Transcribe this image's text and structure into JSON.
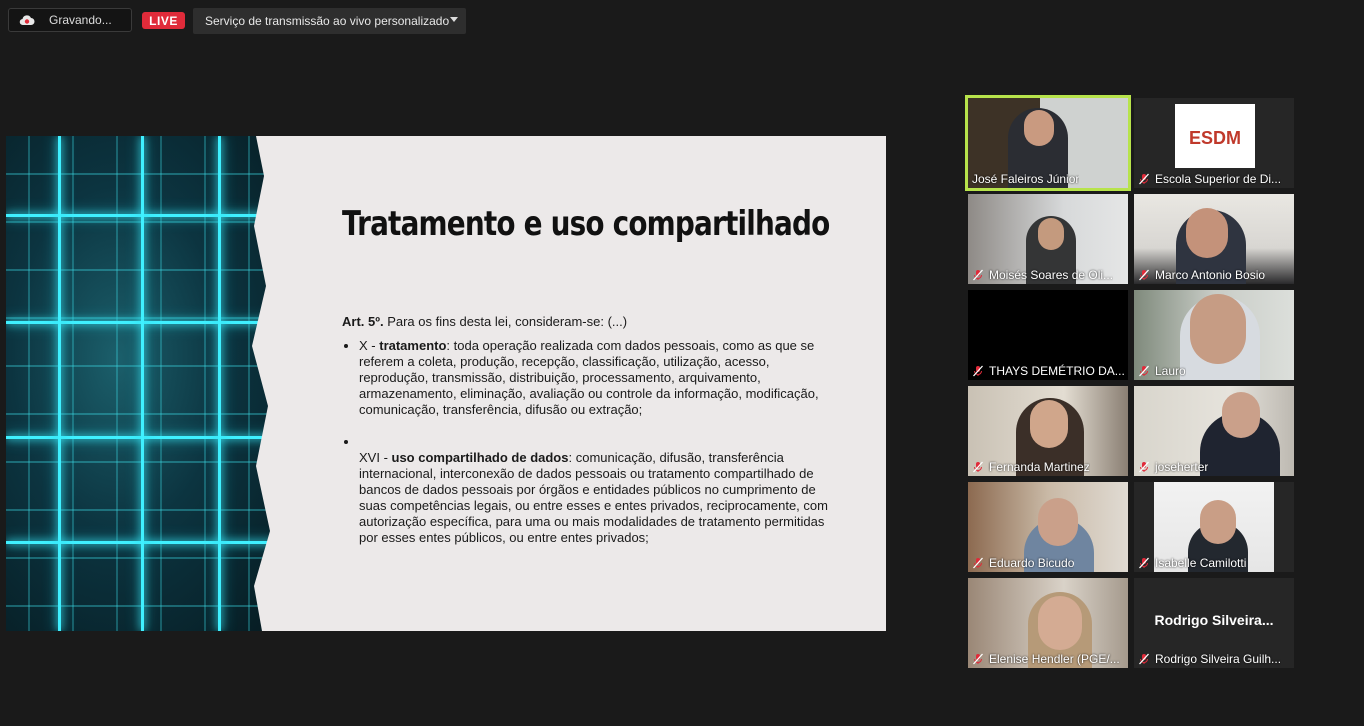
{
  "topbar": {
    "recording_label": "Gravando...",
    "live_label": "LIVE",
    "stream_service": "Serviço de transmissão ao vivo personalizado"
  },
  "slide": {
    "title": "Tratamento e uso compartilhado",
    "lead_bold": "Art. 5º.",
    "lead_text": " Para os fins desta lei, consideram-se: (...)",
    "items": [
      {
        "prefix": "X - ",
        "bold": "tratamento",
        "text": ": toda operação realizada com dados pessoais, como as que se referem a coleta, produção, recepção, classificação, utilização, acesso, reprodução, transmissão, distribuição, processamento, arquivamento, armazenamento, eliminação, avaliação ou controle da informação, modificação, comunicação, transferência, difusão ou extração;"
      },
      {
        "prefix": "XVI - ",
        "bold": "uso compartilhado de dados",
        "text": ": comunicação, difusão, transferência internacional, interconexão de dados pessoais ou tratamento compartilhado de bancos de dados pessoais por órgãos e entidades públicos no cumprimento de suas competências legais, ou entre esses e entes privados, reciprocamente, com autorização específica, para uma ou mais modalidades de tratamento permitidas por esses entes públicos, ou entre entes privados;"
      }
    ]
  },
  "participants": [
    {
      "name": "José Faleiros Júnior",
      "muted": false,
      "active": true
    },
    {
      "name": "Escola Superior de Di...",
      "muted": true,
      "logo": "ESDM"
    },
    {
      "name": "Moisés Soares de Oli...",
      "muted": true
    },
    {
      "name": "Marco Antonio Bosio",
      "muted": true
    },
    {
      "name": "THAYS DEMÉTRIO DA...",
      "muted": true
    },
    {
      "name": "Lauro",
      "muted": true
    },
    {
      "name": "Fernanda Martinez",
      "muted": true
    },
    {
      "name": "joseherter",
      "muted": true
    },
    {
      "name": "Eduardo Bicudo",
      "muted": true
    },
    {
      "name": "Isabelle Camilotti",
      "muted": true
    },
    {
      "name": "Elenise Hendler (PGE/...",
      "muted": true
    },
    {
      "name": "Rodrigo Silveira Guilh...",
      "muted": true,
      "display_name": "Rodrigo  Silveira..."
    }
  ],
  "colors": {
    "background": "#1a1a1a",
    "live_red": "#e02b3a",
    "active_speaker": "#b7e34b",
    "mute_red": "#e02b3a"
  }
}
